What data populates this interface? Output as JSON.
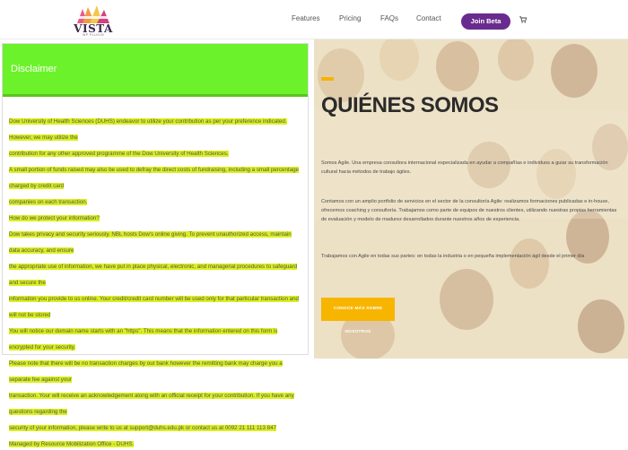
{
  "header": {
    "logo_text": "VISTA",
    "logo_sub": "WP PLUGIN",
    "nav": [
      "Features",
      "Pricing",
      "FAQs",
      "Contact"
    ],
    "join_label": "Join Beta",
    "cart_icon": "cart-icon"
  },
  "disclaimer": {
    "title": "Disclaimer",
    "lines": [
      "Dow University of Health Sciences (DUHS) endeavor to utilize your contribution as per your preference indicated. However, we may utilize the",
      "contribution for any other approved programme of the Dow University of Health Sciences.",
      "A small portion of funds raised may also be used to defray the direct costs of fundraising, including a small percentage charged by credit card",
      "companies on each transaction.",
      "How do we protect your information?",
      "Dow takes privacy and security seriously. NBL hosts Dow's online giving. To prevent unauthorized access, maintain data accuracy, and ensure",
      "the appropriate use of information, we have put in place physical, electronic, and managerial procedures to safeguard and secure the",
      "information you provide to us online. Your credit/credit card number will be used only for that particular transaction and will not be stored",
      "You will notice our domain name starts with an \"https\". This means that the information entered on this form is encrypted for your security.",
      "Please note that there will be no transaction charges by our bank however the remitting bank may charge you a separate fee against your",
      "transaction. Your will receive an acknowledgement along with an official receipt for your contribution. If you have any questions regarding the",
      "security of your information, please write to us at support@duhs.edu.pk or contact us at 0092 21 111 113 847",
      "Managed by Resource Mobilization Office - DUHS."
    ]
  },
  "hero": {
    "title": "QUIÉNES SOMOS",
    "p1": "Somos Agile. Una empresa consultora internacional especializada en ayudar a compañías e individuos a guiar su transformación cultural hacia métodos de trabajo ágiles.",
    "p2": "Contamos con un amplio portfolio de servicios en el sector de la consultoría Agile: realizamos formaciones publicadas e in-house, ofrecemos coaching y consultoría. Trabajamos como parte de equipos de nuestros clientes, utilizando nuestras propias herramientas de evaluación y modelo de madurez desarrollados durante nuestros años de experiencia.",
    "p3": "Trabajamos con Agile en todas sus partes: en todas la industria o en pequeña implementación ágil desde el primer día",
    "cta_label": "CONOCE MÁS SOBRE NOSOTROS"
  }
}
